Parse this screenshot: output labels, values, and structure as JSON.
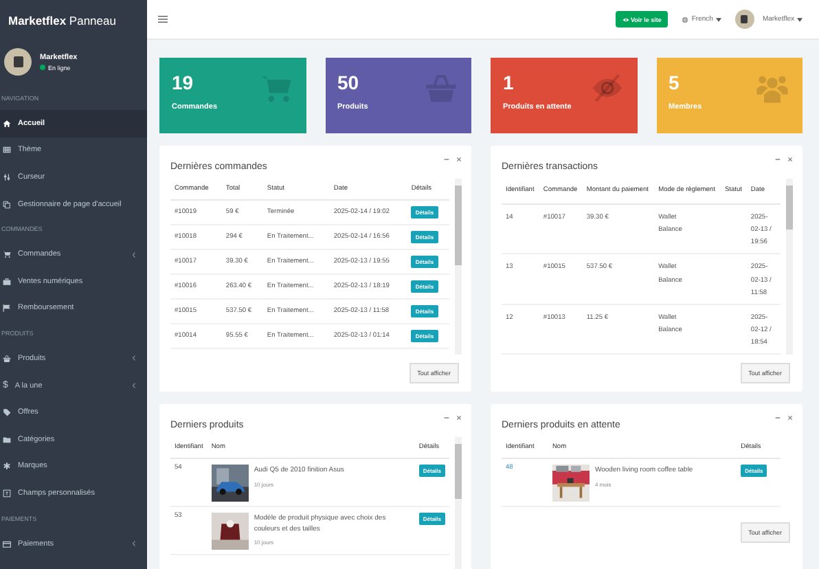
{
  "sidebar": {
    "brand": "**Marketflex** Panneau",
    "user": {
      "name": "Marketflex",
      "status": "En ligne",
      "online": true
    },
    "sections": [
      {
        "title": "NAVIGATION",
        "items": [
          {
            "label": "Accueil",
            "selected": true,
            "expandable": false
          },
          {
            "label": "Thème",
            "selected": false,
            "expandable": false
          },
          {
            "label": "Curseur",
            "selected": false,
            "expandable": false
          },
          {
            "label": "Gestionnaire de page d'accueil",
            "selected": false,
            "expandable": false
          }
        ]
      },
      {
        "title": "COMMANDES",
        "items": [
          {
            "label": "Commandes",
            "selected": false,
            "expandable": true
          },
          {
            "label": "Ventes numériques",
            "selected": false,
            "expandable": false
          },
          {
            "label": "Remboursement",
            "selected": false,
            "expandable": false
          }
        ]
      },
      {
        "title": "PRODUITS",
        "items": [
          {
            "label": "Produits",
            "selected": false,
            "expandable": true
          },
          {
            "label": "A la une",
            "glyph": "$",
            "selected": false,
            "expandable": true
          },
          {
            "label": "Offres",
            "selected": false,
            "expandable": false
          },
          {
            "label": "Catégories",
            "selected": false,
            "expandable": false
          },
          {
            "label": "Marques",
            "selected": false,
            "expandable": false
          },
          {
            "label": "Champs personnalisés",
            "selected": false,
            "expandable": false
          }
        ]
      },
      {
        "title": "PAIEMENTS",
        "items": [
          {
            "label": "Paiements",
            "selected": false,
            "expandable": true
          }
        ]
      }
    ]
  },
  "topbar": {
    "view_site": "Voir le site",
    "language": "French",
    "user": "Marketflex"
  },
  "stats": [
    {
      "value": "19",
      "label": "Commandes",
      "color": "#1aa085"
    },
    {
      "value": "50",
      "label": "Produits",
      "color": "#605ca8"
    },
    {
      "value": "1",
      "label": "Produits en attente",
      "color": "#dd4b39"
    },
    {
      "value": "5",
      "label": "Membres",
      "color": "#f0b33c"
    }
  ],
  "orders": {
    "title": "Dernières commandes",
    "columns": [
      "Commande",
      "Total",
      "Statut",
      "Date",
      "Détails"
    ],
    "rows": [
      {
        "order": "#10019",
        "total": "59 €",
        "status": "Terminée",
        "date": "2025-02-14 / 19:02",
        "details": "Détails"
      },
      {
        "order": "#10018",
        "total": "294 €",
        "status": "En Traitement...",
        "date": "2025-02-14 / 16:56",
        "details": "Détails"
      },
      {
        "order": "#10017",
        "total": "39.30 €",
        "status": "En Traitement...",
        "date": "2025-02-13 / 19:55",
        "details": "Détails"
      },
      {
        "order": "#10016",
        "total": "263.40 €",
        "status": "En Traitement...",
        "date": "2025-02-13 / 18:19",
        "details": "Détails"
      },
      {
        "order": "#10015",
        "total": "537.50 €",
        "status": "En Traitement...",
        "date": "2025-02-13 / 11:58",
        "details": "Détails"
      },
      {
        "order": "#10014",
        "total": "95.55 €",
        "status": "En Traitement...",
        "date": "2025-02-13 / 01:14",
        "details": "Détails"
      }
    ],
    "more": "Tout afficher"
  },
  "transactions": {
    "title": "Dernières transactions",
    "columns": [
      "Identifiant",
      "Commande",
      "Montant du paiement",
      "Mode de règlement",
      "Statut",
      "Date"
    ],
    "rows": [
      {
        "id": "14",
        "order": "#10017",
        "amount": "39.30 €",
        "method": "Wallet Balance",
        "date": "2025-02-13 / 19:56"
      },
      {
        "id": "13",
        "order": "#10015",
        "amount": "537.50 €",
        "method": "Wallet Balance",
        "date": "2025-02-13 / 11:58"
      },
      {
        "id": "12",
        "order": "#10013",
        "amount": "11.25 €",
        "method": "Wallet Balance",
        "date": "2025-02-12 / 18:54"
      }
    ],
    "more": "Tout afficher"
  },
  "products": {
    "title": "Derniers produits",
    "columns": [
      "Identifiant",
      "Nom",
      "Détails"
    ],
    "rows": [
      {
        "id": "54",
        "name": "Audi Q5 de 2010 finition Asus",
        "age": "10 jours",
        "details": "Détails"
      },
      {
        "id": "53",
        "name": "Modèle de produit physique avec choix des couleurs et des tailles",
        "age": "10 jours",
        "details": "Détails"
      }
    ]
  },
  "pending": {
    "title": "Derniers produits en attente",
    "columns": [
      "Identifiant",
      "Nom",
      "Détails"
    ],
    "rows": [
      {
        "id": "48",
        "name": "Wooden living room coffee table",
        "age": "4 mois",
        "details": "Détails"
      }
    ],
    "more": "Tout afficher"
  }
}
